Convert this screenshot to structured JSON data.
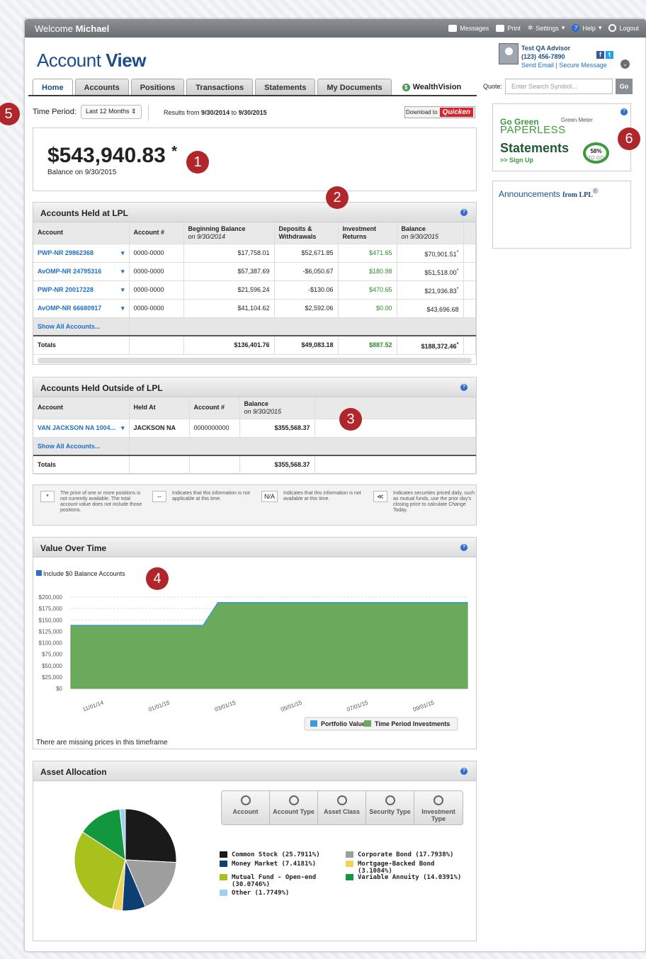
{
  "topbar": {
    "welcome": "Welcome",
    "user": "Michael",
    "messages": "Messages",
    "print": "Print",
    "settings": "Settings",
    "help": "Help",
    "logout": "Logout"
  },
  "brand": {
    "light": "Account",
    "bold": "View"
  },
  "advisor": {
    "name": "Test QA Advisor",
    "phone": "(123) 456-7890",
    "links": "Send Email | Secure Message"
  },
  "tabs": [
    "Home",
    "Accounts",
    "Positions",
    "Transactions",
    "Statements",
    "My Documents",
    "WealthVision"
  ],
  "quote": {
    "label": "Quote:",
    "placeholder": "Enter Search Symbol...",
    "go": "Go"
  },
  "time_period": {
    "label": "Time Period:",
    "value": "Last 12 Months",
    "results_prefix": "Results from",
    "from": "9/30/2014",
    "to_word": "to",
    "to": "9/30/2015",
    "download": "Download to",
    "quicken": "Quicken"
  },
  "balance": {
    "amount": "$543,940.83",
    "mark": "*",
    "note": "Balance on 9/30/2015"
  },
  "badges": [
    "1",
    "2",
    "3",
    "4",
    "5",
    "6"
  ],
  "lpl": {
    "title": "Accounts Held at LPL",
    "headers": {
      "account": "Account",
      "number": "Account #",
      "begin": "Beginning Balance",
      "begin_date": "on 9/30/2014",
      "deposits": "Deposits &",
      "deposits2": "Withdrawals",
      "returns": "Investment",
      "returns2": "Returns",
      "balance": "Balance",
      "balance_date": "on 9/30/2015"
    },
    "rows": [
      {
        "account": "PWP-NR 29862368",
        "number": "0000-0000",
        "begin": "$17,758.01",
        "deposits": "$52,671.85",
        "returns": "$471.65",
        "balance": "$70,901.51",
        "mark": "*"
      },
      {
        "account": "AvOMP-NR 24795316",
        "number": "0000-0000",
        "begin": "$57,387.69",
        "deposits": "-$6,050.67",
        "returns": "$180.98",
        "balance": "$51,518.00",
        "mark": "*"
      },
      {
        "account": "PWP-NR 20017228",
        "number": "0000-0000",
        "begin": "$21,596.24",
        "deposits": "-$130.06",
        "returns": "$470.65",
        "balance": "$21,936.83",
        "mark": "*"
      },
      {
        "account": "AvOMP-NR 66680917",
        "number": "0000-0000",
        "begin": "$41,104.62",
        "deposits": "$2,592.06",
        "returns": "$0.00",
        "balance": "$43,696.68",
        "mark": ""
      }
    ],
    "show_all": "Show All Accounts...",
    "totals": {
      "label": "Totals",
      "begin": "$136,401.76",
      "deposits": "$49,083.18",
      "returns": "$887.52",
      "balance": "$188,372.46",
      "mark": "*"
    }
  },
  "outside": {
    "title": "Accounts Held Outside of LPL",
    "headers": {
      "account": "Account",
      "held": "Held At",
      "number": "Account #",
      "balance": "Balance",
      "balance_date": "on 9/30/2015"
    },
    "rows": [
      {
        "account": "VAN JACKSON NA 1004...",
        "held": "JACKSON NA",
        "number": "0000000000",
        "balance": "$355,568.37"
      }
    ],
    "show_all": "Show All Accounts...",
    "totals": {
      "label": "Totals",
      "balance": "$355,568.37"
    }
  },
  "legend": [
    {
      "key": "*",
      "text": "The price of one or more positions is not currently available. The total account value does not include those positions."
    },
    {
      "key": "--",
      "text": "Indicates that this information is not applicable at this time."
    },
    {
      "key": "N/A",
      "text": "Indicates that this information is not available at this time."
    },
    {
      "key": "≪",
      "text": "Indicates securities priced daily, such as mutual funds, use the prior day's closing price to calculate Change Today."
    }
  ],
  "value_over_time": {
    "title": "Value Over Time",
    "checkbox": "Include $0 Balance Accounts",
    "missing": "There are missing prices in this timeframe"
  },
  "asset_allocation": {
    "title": "Asset Allocation",
    "buttons": [
      "Account",
      "Account Type",
      "Asset Class",
      "Security Type",
      "Investment Type"
    ]
  },
  "side": {
    "go_green": "Go Green",
    "meter": "Green Meter",
    "paperless": "PAPERLESS",
    "statements": "Statements",
    "signup": ">> Sign Up",
    "percent": "58%",
    "togo": "TO GO",
    "announcements": "Announcements",
    "from": "from LPL",
    "reg": "®"
  },
  "chart_data": [
    {
      "type": "area",
      "title": "Value Over Time",
      "x": [
        "10/01/14",
        "11/01/14",
        "12/01/14",
        "01/01/15",
        "02/01/15",
        "03/01/15",
        "04/01/15",
        "05/01/15",
        "06/01/15",
        "07/01/15",
        "08/01/15",
        "09/01/15",
        "09/30/15"
      ],
      "x_tick_labels": [
        "11/01/14",
        "01/01/15",
        "03/01/15",
        "05/01/15",
        "07/01/15",
        "09/01/15"
      ],
      "y_tick_labels": [
        "$200,000",
        "$175,000",
        "$150,000",
        "$125,000",
        "$100,000",
        "$75,000",
        "$50,000",
        "$25,000",
        "$0"
      ],
      "ylim": [
        0,
        200000
      ],
      "series": [
        {
          "name": "Portfolio Value",
          "color": "#3b9ad9",
          "values": [
            138000,
            138000,
            138000,
            138000,
            138000,
            188000,
            188000,
            188000,
            188000,
            188000,
            188000,
            188000,
            188000
          ]
        },
        {
          "name": "Time Period Investments",
          "color": "#6aaa5a",
          "values": [
            138000,
            138000,
            138000,
            138000,
            138000,
            188000,
            188000,
            188000,
            188000,
            188000,
            188000,
            188000,
            188000
          ]
        }
      ],
      "legend": "bottom-right"
    },
    {
      "type": "pie",
      "title": "Asset Allocation",
      "slices": [
        {
          "label": "Common Stock (25.7911%)",
          "value": 25.7911,
          "color": "#1a1a1a"
        },
        {
          "label": "Corporate Bond (17.7938%)",
          "value": 17.7938,
          "color": "#9e9e9e"
        },
        {
          "label": "Money Market (7.4181%)",
          "value": 7.4181,
          "color": "#0d3f73"
        },
        {
          "label": "Mortgage-Backed Bond (3.1084%)",
          "value": 3.1084,
          "color": "#f2d35a"
        },
        {
          "label": "Mutual Fund - Open-end (30.0746%)",
          "value": 30.0746,
          "color": "#a9c11d"
        },
        {
          "label": "Variable Annuity (14.0391%)",
          "value": 14.0391,
          "color": "#12973f"
        },
        {
          "label": "Other (1.7749%)",
          "value": 1.7749,
          "color": "#9dd2ef"
        }
      ]
    }
  ]
}
